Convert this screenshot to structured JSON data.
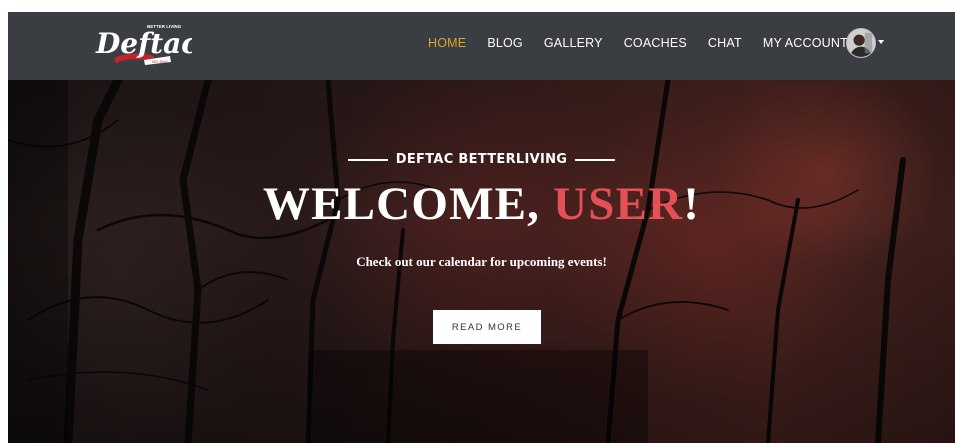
{
  "logo": {
    "tagline": "BETTER LIVING",
    "wordmark": "Deftac",
    "ribbon": "NO JINX"
  },
  "nav": {
    "items": [
      {
        "label": "HOME",
        "active": true
      },
      {
        "label": "BLOG",
        "active": false
      },
      {
        "label": "GALLERY",
        "active": false
      },
      {
        "label": "COACHES",
        "active": false
      },
      {
        "label": "CHAT",
        "active": false
      }
    ],
    "account_label": "MY ACCOUNT",
    "account_icon": "chevron-down-icon"
  },
  "hero": {
    "eyebrow": "DEFTAC BETTERLIVING",
    "headline_prefix": "WELCOME, ",
    "headline_accent": "USER",
    "headline_suffix": "!",
    "subtext": "Check out our calendar for upcoming events!",
    "button_label": "READ MORE"
  },
  "colors": {
    "navbar_bg": "#3a3d41",
    "nav_active": "#e0a526",
    "accent_red": "#e35157",
    "text_white": "#ffffff"
  }
}
